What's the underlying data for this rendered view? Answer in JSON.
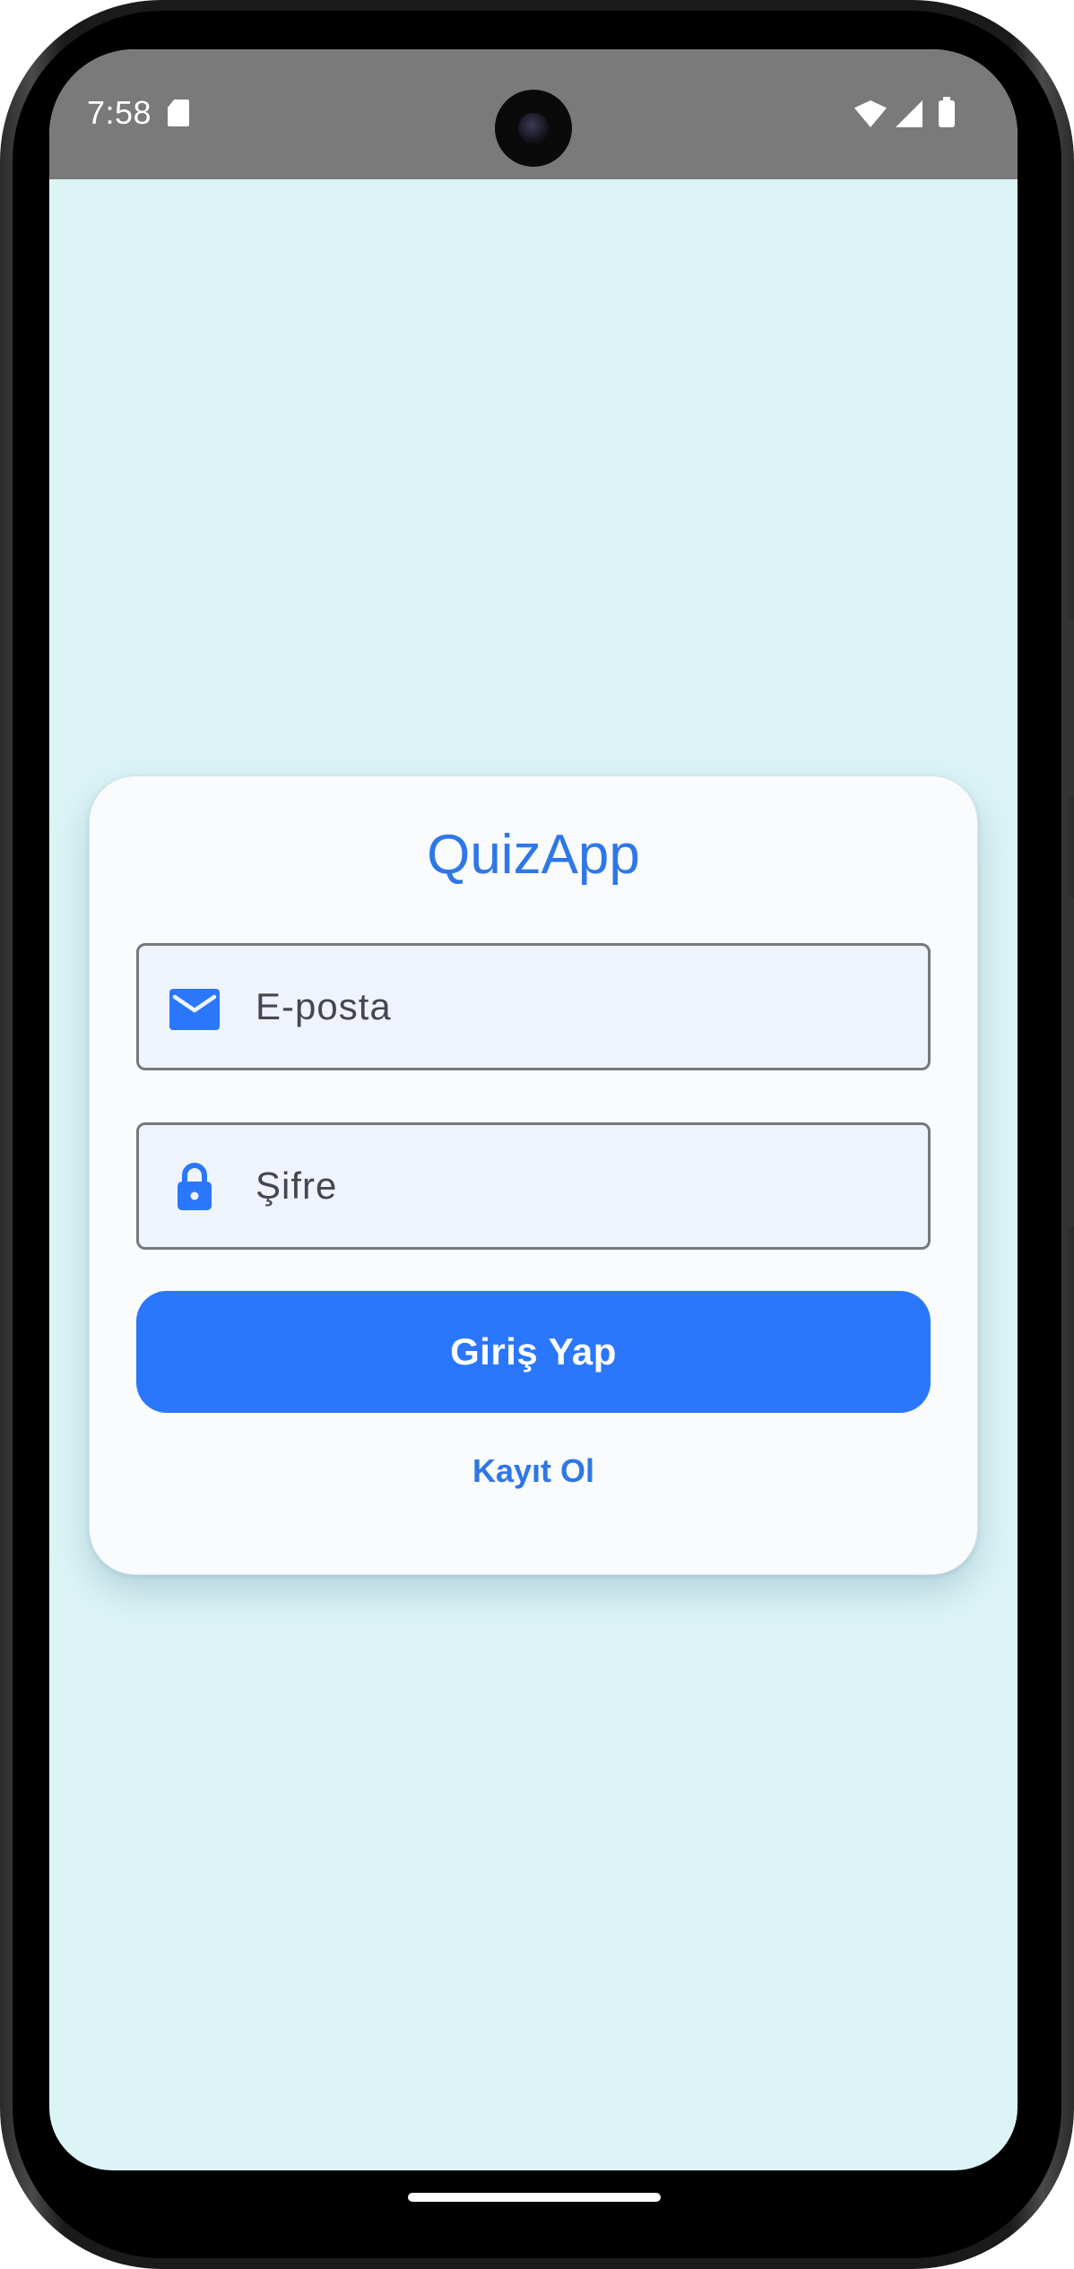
{
  "status_bar": {
    "time": "7:58",
    "icons": [
      "sd-card-icon",
      "wifi-icon",
      "signal-icon",
      "battery-icon"
    ]
  },
  "login": {
    "app_title": "QuizApp",
    "email_field": {
      "placeholder": "E-posta",
      "value": "",
      "icon": "mail-icon"
    },
    "password_field": {
      "placeholder": "Şifre",
      "value": "",
      "icon": "lock-icon"
    },
    "login_button_label": "Giriş Yap",
    "register_link_label": "Kayıt Ol"
  },
  "colors": {
    "background": "#dcf4f6",
    "card": "#f9fbfd",
    "accent": "#2b77fb",
    "title": "#2e77e8",
    "field_fill": "#eff4fc",
    "field_border": "#75787c",
    "status_bar": "#7a7a7a"
  }
}
